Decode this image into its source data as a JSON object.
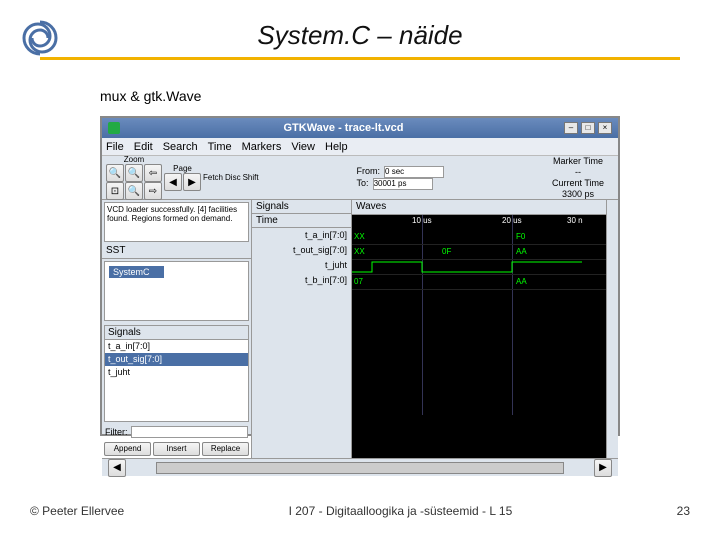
{
  "slide": {
    "title": "System.C – näide",
    "subtitle": "mux & gtk.Wave",
    "copyright": "© Peeter Ellervee",
    "course": "I 207 - Digitaalloogika ja -süsteemid - L 15",
    "page": "23"
  },
  "app": {
    "titlebar": "GTKWave - trace-lt.vcd",
    "menu": [
      "File",
      "Edit",
      "Search",
      "Time",
      "Markers",
      "View",
      "Help"
    ],
    "messages": "VCD loader successfully.\n[4] facilities found.\nRegions formed on demand.",
    "sst_label": "SST",
    "tree_item": "SystemC",
    "signals_label": "Signals",
    "sig_list": [
      "t_a_in[7:0]",
      "t_out_sig[7:0]",
      "t_juht",
      ""
    ],
    "sig_sel_index": 1,
    "filter_label": "Filter:",
    "buttons": [
      "Append",
      "Insert",
      "Replace"
    ],
    "toolbar": {
      "zoom": "Zoom",
      "page": "Page",
      "fetch": "Fetch",
      "disc": "Disc",
      "shift": "Shift",
      "from_label": "From:",
      "from_value": "0 sec",
      "to_label": "To:",
      "to_value": "30001 ps",
      "marker_label": "Marker Time",
      "marker_value": "--",
      "current_label": "Current Time",
      "current_value": "3300 ps"
    },
    "wave": {
      "signals_hdr": "Signals",
      "time_hdr": "Time",
      "waves_hdr": "Waves",
      "rows": [
        "t_a_in[7:0]",
        "t_out_sig[7:0]",
        "t_juht",
        "t_b_in[7:0]"
      ],
      "ticks": [
        "10 us",
        "20 us",
        "30 n"
      ],
      "busvals": [
        "XX",
        "F0",
        "XX",
        "0F",
        "AA",
        "07",
        "AA"
      ]
    }
  }
}
